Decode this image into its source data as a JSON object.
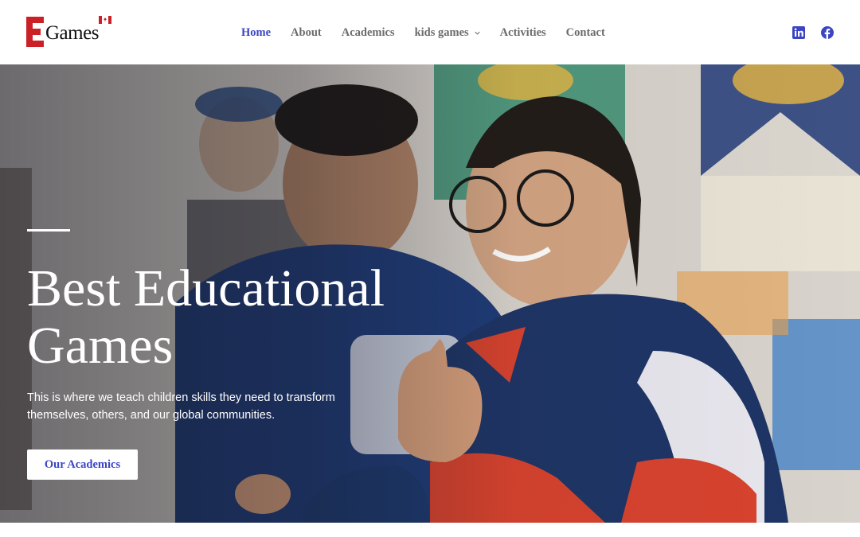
{
  "brand": {
    "name": "Games",
    "logo_letter": "E"
  },
  "nav": {
    "items": [
      {
        "label": "Home",
        "active": true
      },
      {
        "label": "About",
        "active": false
      },
      {
        "label": "Academics",
        "active": false
      },
      {
        "label": "kids games",
        "active": false,
        "has_dropdown": true
      },
      {
        "label": "Activities",
        "active": false
      },
      {
        "label": "Contact",
        "active": false
      }
    ]
  },
  "social": {
    "icons": [
      "linkedin-icon",
      "facebook-icon"
    ]
  },
  "hero": {
    "title": "Best Educational Games",
    "subtitle": "This is where we teach children skills they need to transform themselves, others, and our global communities.",
    "button_label": "Our Academics"
  },
  "colors": {
    "accent": "#3b45c4",
    "brand_red": "#cc2027",
    "nav_text": "#6b6b6b"
  }
}
